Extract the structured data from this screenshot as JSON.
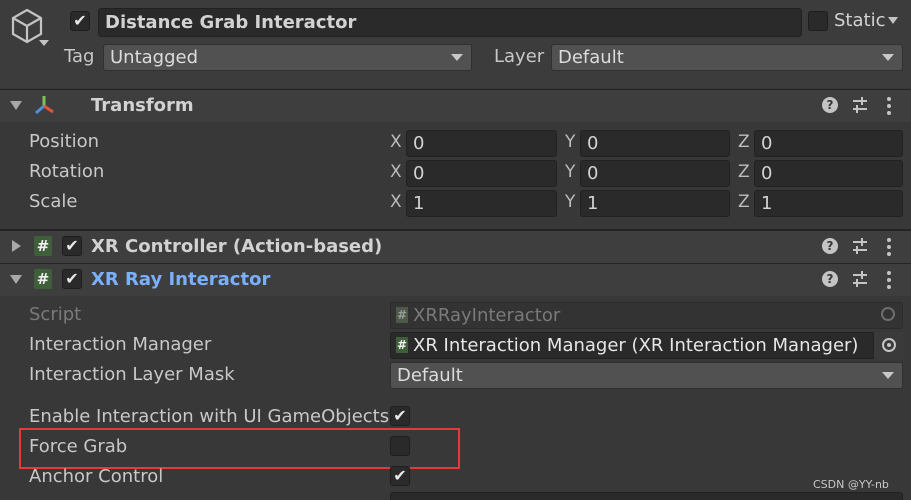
{
  "header": {
    "active_checked": true,
    "name": "Distance Grab Interactor",
    "static_label": "Static",
    "static_checked": false,
    "tag_label": "Tag",
    "tag_value": "Untagged",
    "layer_label": "Layer",
    "layer_value": "Default"
  },
  "transform": {
    "title": "Transform",
    "rows": [
      {
        "label": "Position",
        "x": "0",
        "y": "0",
        "z": "0"
      },
      {
        "label": "Rotation",
        "x": "0",
        "y": "0",
        "z": "0"
      },
      {
        "label": "Scale",
        "x": "1",
        "y": "1",
        "z": "1"
      }
    ],
    "axis_x": "X",
    "axis_y": "Y",
    "axis_z": "Z"
  },
  "xr_controller": {
    "title": "XR Controller (Action-based)",
    "enabled": true,
    "expanded": false
  },
  "xr_ray_interactor": {
    "title": "XR Ray Interactor",
    "enabled": true,
    "expanded": true,
    "script_label": "Script",
    "script_value": "XRRayInteractor",
    "interaction_manager_label": "Interaction Manager",
    "interaction_manager_value": "XR Interaction Manager (XR Interaction Manager)",
    "layer_mask_label": "Interaction Layer Mask",
    "layer_mask_value": "Default",
    "enable_ui_label": "Enable Interaction with UI GameObjects",
    "enable_ui_checked": true,
    "force_grab_label": "Force Grab",
    "force_grab_checked": false,
    "anchor_control_label": "Anchor Control",
    "anchor_control_checked": true
  },
  "watermark": "CSDN @YY-nb",
  "colors": {
    "background": "#383838",
    "field": "#2a2a2a",
    "accent_blue": "#7bb0ff",
    "highlight_red": "#e23b3b",
    "script_green": "#3f5f3a"
  },
  "icons": {
    "gameobject": "cube-icon",
    "transform": "transform-axes-icon",
    "script": "hash-script-icon",
    "help": "help-icon",
    "presets": "sliders-icon",
    "menu": "kebab-menu-icon",
    "object_picker": "object-picker-icon"
  }
}
